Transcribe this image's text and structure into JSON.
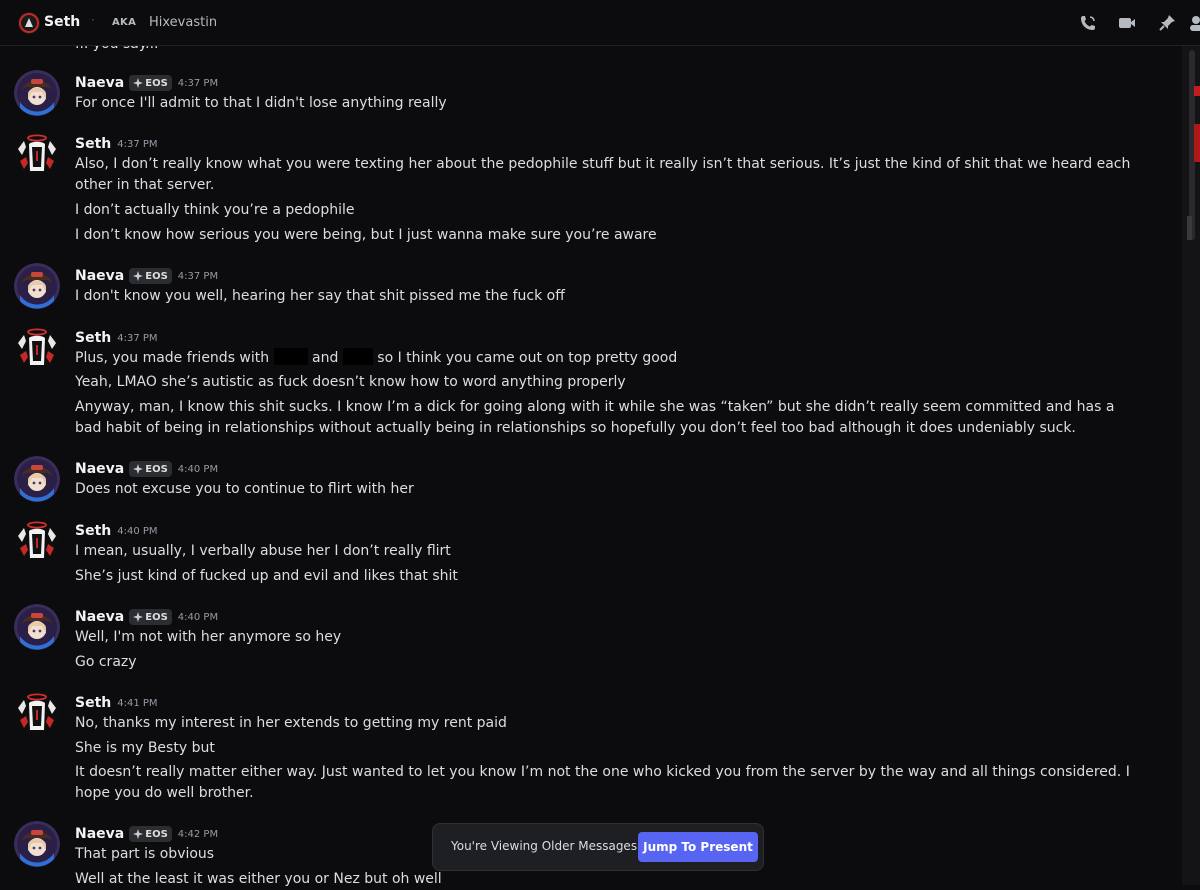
{
  "header": {
    "name": "Seth",
    "separator": "·",
    "aka_label": "AKA",
    "alias": "Hixevastin"
  },
  "clipped_line": "... you say...",
  "messages": [
    {
      "author": "Naeva",
      "tag": "EOS",
      "time": "4:37 PM",
      "lines": [
        "For once I'll admit to that I didn't lose anything really"
      ]
    },
    {
      "author": "Seth",
      "time": "4:37 PM",
      "lines": [
        "Also, I don’t really know what you were texting her about the pedophile stuff but it really isn’t that serious. It’s just the kind of shit that we heard each other in that server.",
        "I don’t actually think you’re a pedophile",
        "I don’t know how serious you were being, but I just wanna make sure you’re aware"
      ]
    },
    {
      "author": "Naeva",
      "tag": "EOS",
      "time": "4:37 PM",
      "lines": [
        "I don't know you well, hearing her say that shit pissed me the fuck off"
      ]
    },
    {
      "author": "Seth",
      "time": "4:37 PM",
      "lines_parts": {
        "a": "Plus, you made friends with",
        "b": "and",
        "c": "so I think you came out on top pretty good"
      },
      "lines": [
        "Yeah, LMAO she’s autistic as fuck doesn’t know how to word anything properly",
        "Anyway, man, I know this shit sucks. I know I’m a dick for going along with it while she was “taken” but she didn’t really seem committed and has a bad habit of being in relationships without actually being in relationships so hopefully you don’t feel too bad although it does undeniably suck."
      ]
    },
    {
      "author": "Naeva",
      "tag": "EOS",
      "time": "4:40 PM",
      "lines": [
        "Does not excuse you to continue to flirt with her"
      ]
    },
    {
      "author": "Seth",
      "time": "4:40 PM",
      "lines": [
        "I mean, usually, I verbally abuse her I don’t really flirt",
        "She’s just kind of fucked up and evil and likes that shit"
      ]
    },
    {
      "author": "Naeva",
      "tag": "EOS",
      "time": "4:40 PM",
      "lines": [
        "Well, I'm not with her anymore so hey",
        "Go crazy"
      ]
    },
    {
      "author": "Seth",
      "time": "4:41 PM",
      "lines": [
        "No, thanks my interest in her extends to getting my rent paid",
        "She is my Besty but",
        "It doesn’t really matter either way. Just wanted to let you know I’m not the one who kicked you from the server by the way and all things considered. I hope you do well brother."
      ]
    },
    {
      "author": "Naeva",
      "tag": "EOS",
      "time": "4:42 PM",
      "lines": [
        "That part is obvious",
        "Well at the least it was either you or Nez but oh well"
      ]
    }
  ],
  "banner": {
    "text": "You're Viewing Older Messages",
    "button": "Jump To Present"
  },
  "colors": {
    "background": "#0c0c0e",
    "accent": "#5865f2",
    "text": "#dbdee1",
    "muted": "#949ba4"
  }
}
